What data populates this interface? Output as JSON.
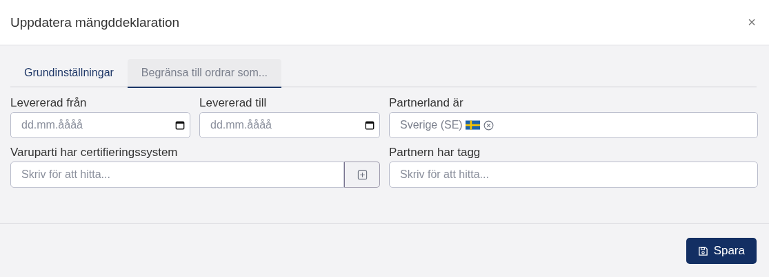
{
  "dialog": {
    "title": "Uppdatera mängddeklaration",
    "close": "×"
  },
  "tabs": [
    {
      "label": "Grundinställningar",
      "selected": false
    },
    {
      "label": "Begränsa till ordrar som...",
      "selected": true
    }
  ],
  "fields": [
    {
      "kind": "date",
      "label": "Levererad från",
      "placeholder": "dd.mm.åååå"
    },
    {
      "kind": "date",
      "label": "Levererad till",
      "placeholder": "dd.mm.åååå"
    },
    {
      "kind": "tags",
      "label": "Partnerland är",
      "tags": [
        "Sverige (SE)"
      ]
    },
    {
      "kind": "search_add",
      "label": "Varuparti har certifieringssystem",
      "placeholder": "Skriv för att hitta..."
    },
    {
      "kind": "search",
      "label": "Partnern har tagg",
      "placeholder": "Skriv för att hitta..."
    }
  ],
  "buttons": [
    {
      "label": "Spara",
      "kind": "save"
    }
  ]
}
